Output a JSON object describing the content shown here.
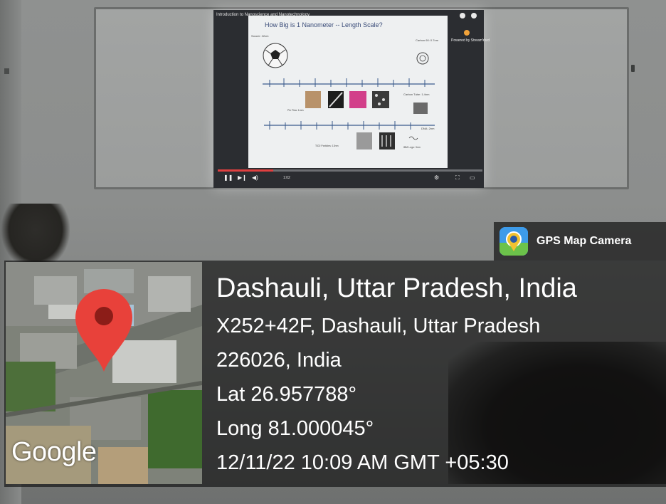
{
  "slide": {
    "video_title": "Introduction to Nanoscience and Nanotechnology",
    "title": "How Big is 1 Nanometer -- Length Scale?",
    "labels": {
      "soccer": "Soccer: 22cm",
      "carbon60": "Carbon 60: 0.7nm",
      "carbon_tube": "Carbon Tube: 1.4nm",
      "dna": "DNA: 2nm",
      "tio2": "TiO2 Particles: 13nm",
      "ibm": "IBM Logo: 3nm",
      "pin_flea": "Pin Flea: 1mm"
    },
    "player_time": "1:02",
    "side_text": "Powered by StreamYard",
    "progress_fraction": 0.21
  },
  "gps": {
    "app_name": "GPS Map Camera",
    "map_provider": "Google",
    "location_title": "Dashauli, Uttar Pradesh, India",
    "address_line1": "X252+42F, Dashauli, Uttar Pradesh",
    "address_line2": "226026, India",
    "lat": "Lat 26.957788°",
    "long": "Long 81.000045°",
    "timestamp": "12/11/22 10:09 AM GMT +05:30",
    "pin_color": "#e8413a"
  }
}
